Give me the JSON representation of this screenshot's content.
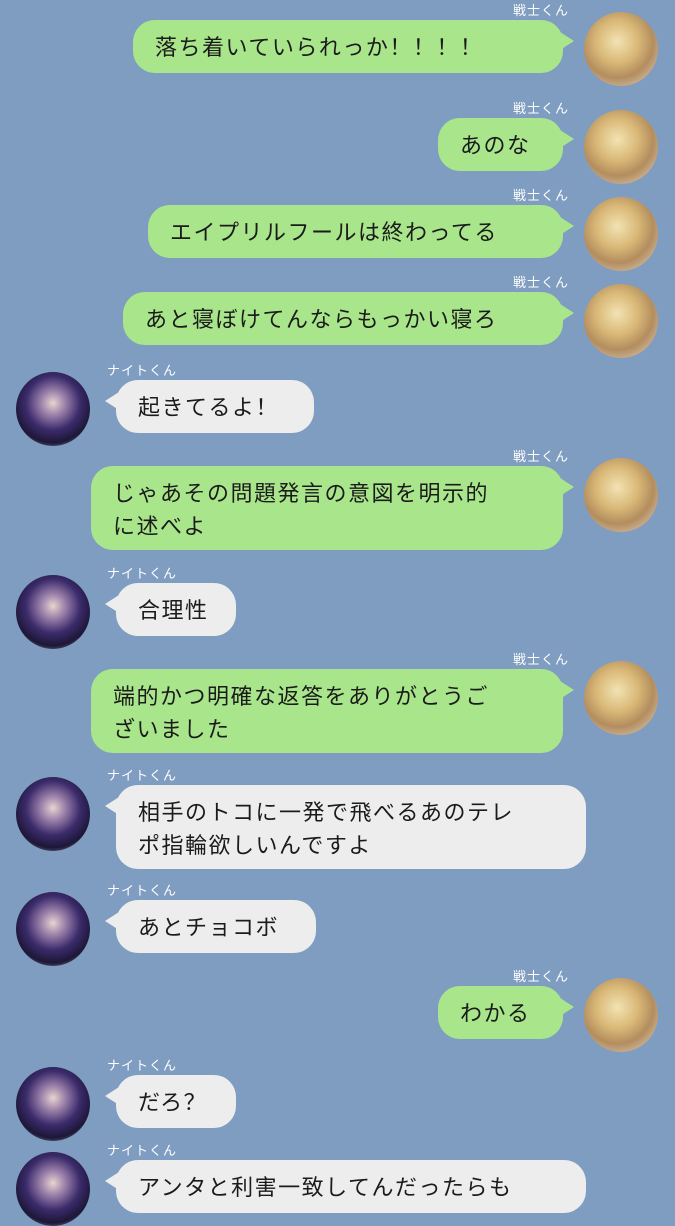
{
  "senders": {
    "warrior": {
      "name": "戦士くん",
      "avatar_icon": "blond-character-avatar-icon"
    },
    "knight": {
      "name": "ナイトくん",
      "avatar_icon": "dark-haired-character-avatar-icon"
    }
  },
  "colors": {
    "background": "#7f9dc0",
    "outgoing_bubble": "#a9e68b",
    "incoming_bubble": "#ededee",
    "name_text": "#ffffff"
  },
  "messages": [
    {
      "sender": "戦士くん",
      "side": "right",
      "lines": [
        "落ち着いていられっか！！！！"
      ]
    },
    {
      "sender": "戦士くん",
      "side": "right",
      "lines": [
        "あのな"
      ]
    },
    {
      "sender": "戦士くん",
      "side": "right",
      "lines": [
        "エイプリルフールは終わってる"
      ]
    },
    {
      "sender": "戦士くん",
      "side": "right",
      "lines": [
        "あと寝ぼけてんならもっかい寝ろ"
      ]
    },
    {
      "sender": "ナイトくん",
      "side": "left",
      "lines": [
        "起きてるよ！"
      ]
    },
    {
      "sender": "戦士くん",
      "side": "right",
      "lines": [
        "じゃあその問題発言の意図を明示的",
        "に述べよ"
      ]
    },
    {
      "sender": "ナイトくん",
      "side": "left",
      "lines": [
        "合理性"
      ]
    },
    {
      "sender": "戦士くん",
      "side": "right",
      "lines": [
        "端的かつ明確な返答をありがとうご",
        "ざいました"
      ]
    },
    {
      "sender": "ナイトくん",
      "side": "left",
      "lines": [
        "相手のトコに一発で飛べるあのテレ",
        "ポ指輪欲しいんですよ"
      ]
    },
    {
      "sender": "ナイトくん",
      "side": "left",
      "lines": [
        "あとチョコボ"
      ]
    },
    {
      "sender": "戦士くん",
      "side": "right",
      "lines": [
        "わかる"
      ]
    },
    {
      "sender": "ナイトくん",
      "side": "left",
      "lines": [
        "だろ？"
      ]
    },
    {
      "sender": "ナイトくん",
      "side": "left",
      "lines": [
        "アンタと利害一致してんだったらも"
      ]
    }
  ]
}
